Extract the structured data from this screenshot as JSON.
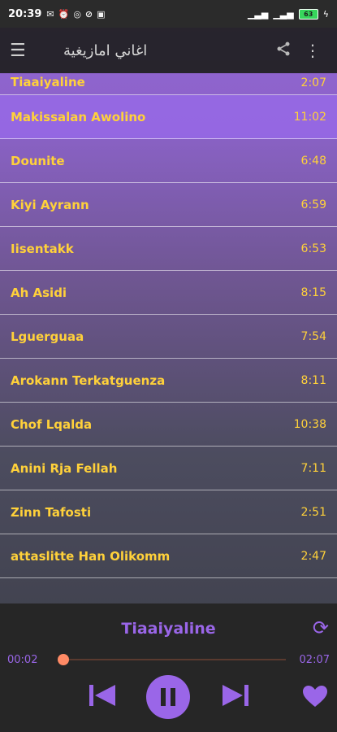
{
  "status_bar": {
    "time": "20:39",
    "battery": "63"
  },
  "app_bar": {
    "title": "اغاني امازيغية"
  },
  "tracks": [
    {
      "title": "Tiaaiyaline",
      "duration": "2:07"
    },
    {
      "title": "Makissalan Awolino",
      "duration": "11:02"
    },
    {
      "title": "Dounite",
      "duration": "6:48"
    },
    {
      "title": "Kiyi Ayrann",
      "duration": "6:59"
    },
    {
      "title": "Iisentakk",
      "duration": "6:53"
    },
    {
      "title": "Ah Asidi",
      "duration": "8:15"
    },
    {
      "title": "Lguerguaa",
      "duration": "7:54"
    },
    {
      "title": "Arokann Terkatguenza",
      "duration": "8:11"
    },
    {
      "title": "Chof Lqalda",
      "duration": "10:38"
    },
    {
      "title": "Anini Rja Fellah",
      "duration": "7:11"
    },
    {
      "title": "Zinn Tafosti",
      "duration": "2:51"
    },
    {
      "title": "attaslitte Han Olikomm",
      "duration": "2:47"
    }
  ],
  "player": {
    "now_playing": "Tiaaiyaline",
    "elapsed": "00:02",
    "total": "02:07",
    "progress_fraction": 0.016
  },
  "colors": {
    "accent": "#9a66e8",
    "track_text": "#ffd13a",
    "seek": "#ff8a65"
  },
  "icons": [
    "menu-icon",
    "share-icon",
    "more-vert-icon",
    "repeat-icon",
    "previous-icon",
    "pause-icon",
    "next-icon",
    "heart-icon"
  ]
}
